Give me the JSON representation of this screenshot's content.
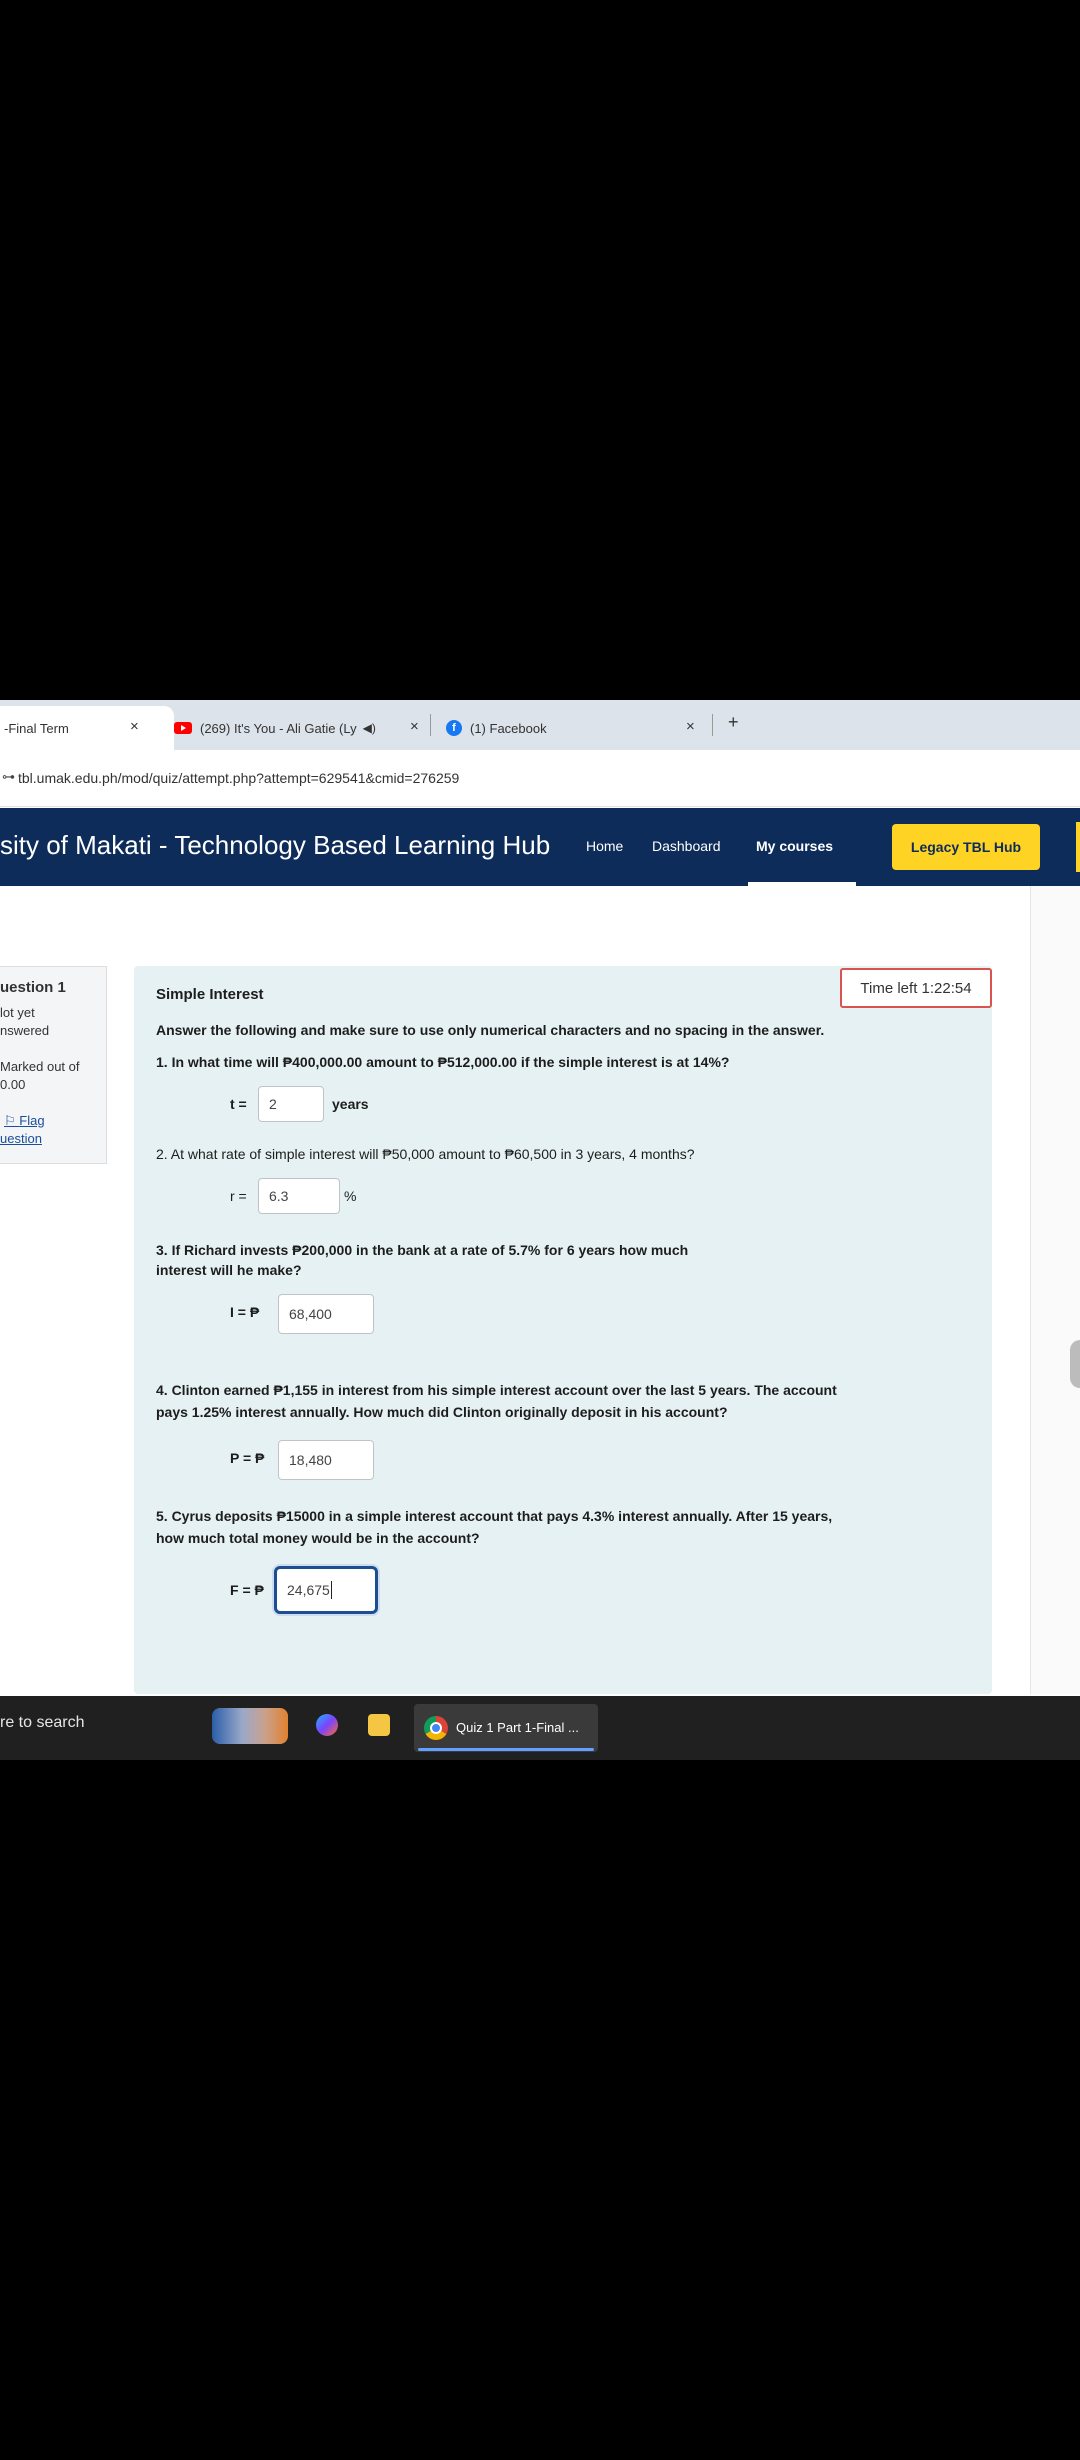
{
  "browser": {
    "tabs": [
      {
        "label": "-Final Term",
        "close": "×"
      },
      {
        "label": "(269) It's You - Ali Gatie (Ly",
        "audio": "◀)",
        "close": "×"
      },
      {
        "label": "(1) Facebook",
        "close": "×"
      }
    ],
    "new_tab": "+",
    "url": "tbl.umak.edu.ph/mod/quiz/attempt.php?attempt=629541&cmid=276259"
  },
  "site": {
    "title": "sity of Makati - Technology Based Learning Hub",
    "nav": [
      "Home",
      "Dashboard",
      "My courses"
    ],
    "active_nav": "My courses",
    "legacy_button": "Legacy TBL Hub",
    "colors": {
      "nav_bg": "#0d2c5a",
      "legacy_btn": "#ffd324",
      "panel_bg": "#e6f1f4",
      "timer_border": "#d9534f"
    }
  },
  "question_info": {
    "title": "uestion 1",
    "status_line1": "lot yet",
    "status_line2": "nswered",
    "marked_line1": "Marked out of",
    "marked_line2": "0.00",
    "flag_line1": "Flag",
    "flag_line2": "uestion"
  },
  "quiz": {
    "timer": "Time left 1:22:54",
    "heading": "Simple Interest",
    "instruction": "Answer the following and make sure to use only numerical characters and no spacing in the answer.",
    "questions": [
      {
        "text": "1. In what time will ₱400,000.00 amount to ₱512,000.00 if the simple interest is at 14%?",
        "label": "t =",
        "value": "2",
        "suffix": "years"
      },
      {
        "text": "2. At what rate of simple interest will ₱50,000 amount to ₱60,500 in 3 years, 4 months?",
        "label": "r =",
        "value": "6.3",
        "suffix": "%"
      },
      {
        "text_line1": "3. If Richard invests ₱200,000 in the bank at a rate of 5.7% for 6 years how much",
        "text_line2": "interest will he make?",
        "label": "I = ₱",
        "value": "68,400"
      },
      {
        "text_line1": "4. Clinton earned ₱1,155 in interest from his simple interest account over the last 5 years. The account",
        "text_line2": "pays 1.25% interest annually. How much did Clinton originally deposit in his account?",
        "label": "P = ₱",
        "value": "18,480"
      },
      {
        "text_line1": "5. Cyrus deposits ₱15000 in a simple interest account that pays 4.3% interest annually. After 15 years,",
        "text_line2": "how much total money would be in the account?",
        "label": "F = ₱",
        "value": "24,675"
      }
    ]
  },
  "taskbar": {
    "search": "re to search",
    "chrome_label": "Quiz 1 Part 1-Final ..."
  }
}
